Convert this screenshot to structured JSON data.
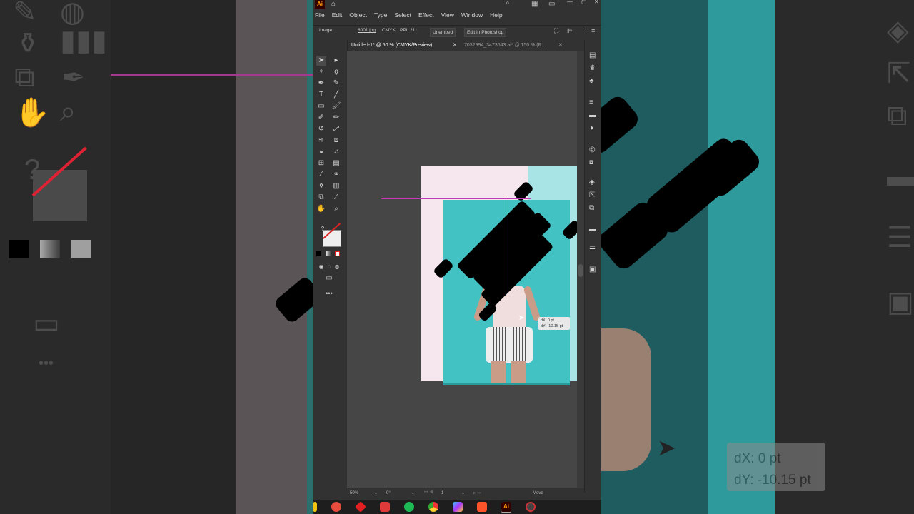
{
  "menu": {
    "logo": "Ai",
    "items": [
      "File",
      "Edit",
      "Object",
      "Type",
      "Select",
      "Effect",
      "View",
      "Window",
      "Help"
    ]
  },
  "control_bar": {
    "mode": "Image",
    "filename": "8001.jpg",
    "colormode": "CMYK",
    "ppi": "PPI: 211",
    "unembed": "Unembed",
    "edit_photoshop": "Edit In Photoshop"
  },
  "tabs": [
    {
      "label": "Untitled-1* @ 50 % (CMYK/Preview)",
      "active": true
    },
    {
      "label": "7032994_3473543.ai* @ 150 % (R...",
      "active": false
    }
  ],
  "tooltip": {
    "dx": "dX: 0 pt",
    "dy": "dY: -10.15 pt"
  },
  "status": {
    "zoom": "50%",
    "rotation": "0°",
    "artboard": "1",
    "tool": "Move"
  },
  "colors": {
    "accent_guide": "#c13ab1",
    "teal": "#43c2c4",
    "pink": "#f6e7ee"
  }
}
